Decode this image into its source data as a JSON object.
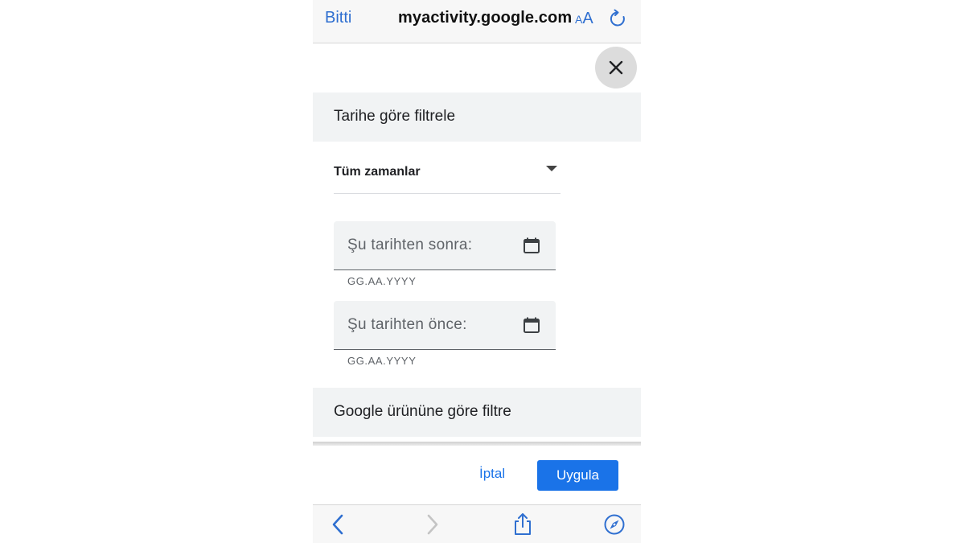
{
  "browser": {
    "done_label": "Bitti",
    "url": "myactivity.google.com",
    "aa_small": "A",
    "aa_large": "A"
  },
  "date_filter": {
    "title": "Tarihe göre filtrele",
    "range_value": "Tüm zamanlar",
    "after_label": "Şu tarihten sonra:",
    "after_hint": "GG.AA.YYYY",
    "before_label": "Şu tarihten önce:",
    "before_hint": "GG.AA.YYYY"
  },
  "product_filter": {
    "title": "Google ürününe göre filtre"
  },
  "actions": {
    "cancel_label": "İptal",
    "apply_label": "Uygula"
  },
  "colors": {
    "accent": "#1a73e8",
    "ios_blue": "#2f6fd0",
    "section_bg": "#f1f3f4"
  },
  "icons": {
    "close": "close-icon",
    "calendar": "calendar-icon",
    "reload": "reload-icon",
    "back": "back-chevron-icon",
    "forward": "forward-chevron-icon",
    "share": "share-icon",
    "compass": "compass-icon"
  }
}
